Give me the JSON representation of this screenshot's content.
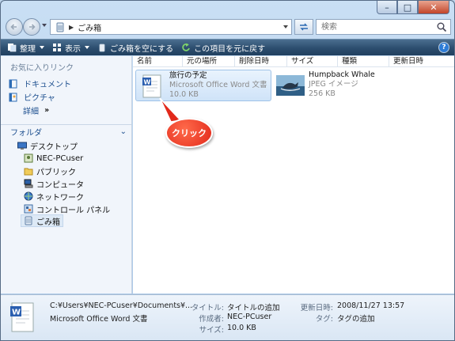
{
  "address": {
    "crumb": "ごみ箱"
  },
  "search": {
    "placeholder": "検索"
  },
  "toolbar": {
    "organize": "整理",
    "views": "表示",
    "empty_bin": "ごみ箱を空にする",
    "restore": "この項目を元に戻す"
  },
  "nav": {
    "favorites_title": "お気に入りリンク",
    "favorites": [
      {
        "label": "ドキュメント"
      },
      {
        "label": "ピクチャ"
      }
    ],
    "more": "詳細",
    "folders_title": "フォルダ",
    "tree": [
      {
        "label": "デスクトップ"
      },
      {
        "label": "NEC-PCuser"
      },
      {
        "label": "パブリック"
      },
      {
        "label": "コンピュータ"
      },
      {
        "label": "ネットワーク"
      },
      {
        "label": "コントロール パネル"
      },
      {
        "label": "ごみ箱"
      }
    ]
  },
  "columns": [
    "名前",
    "元の場所",
    "削除日時",
    "サイズ",
    "種類",
    "更新日時"
  ],
  "files": [
    {
      "name": "旅行の予定",
      "type": "Microsoft Office Word 文書",
      "size": "10.0 KB"
    },
    {
      "name": "Humpback Whale",
      "type": "JPEG イメージ",
      "size": "256 KB"
    }
  ],
  "callout": "クリック",
  "details": {
    "path": "C:¥Users¥NEC-PCuser¥Documents¥...",
    "type": "Microsoft Office Word 文書",
    "title_label": "タイトル:",
    "title_value": "タイトルの追加",
    "author_label": "作成者:",
    "author_value": "NEC-PCuser",
    "size_label": "サイズ:",
    "size_value": "10.0 KB",
    "modified_label": "更新日時:",
    "modified_value": "2008/11/27 13:57",
    "tags_label": "タグ:",
    "tags_value": "タグの追加"
  },
  "colors": {
    "accent": "#1d4f8f",
    "toolbar": "#2c4d6e",
    "callout": "#e2291b"
  }
}
